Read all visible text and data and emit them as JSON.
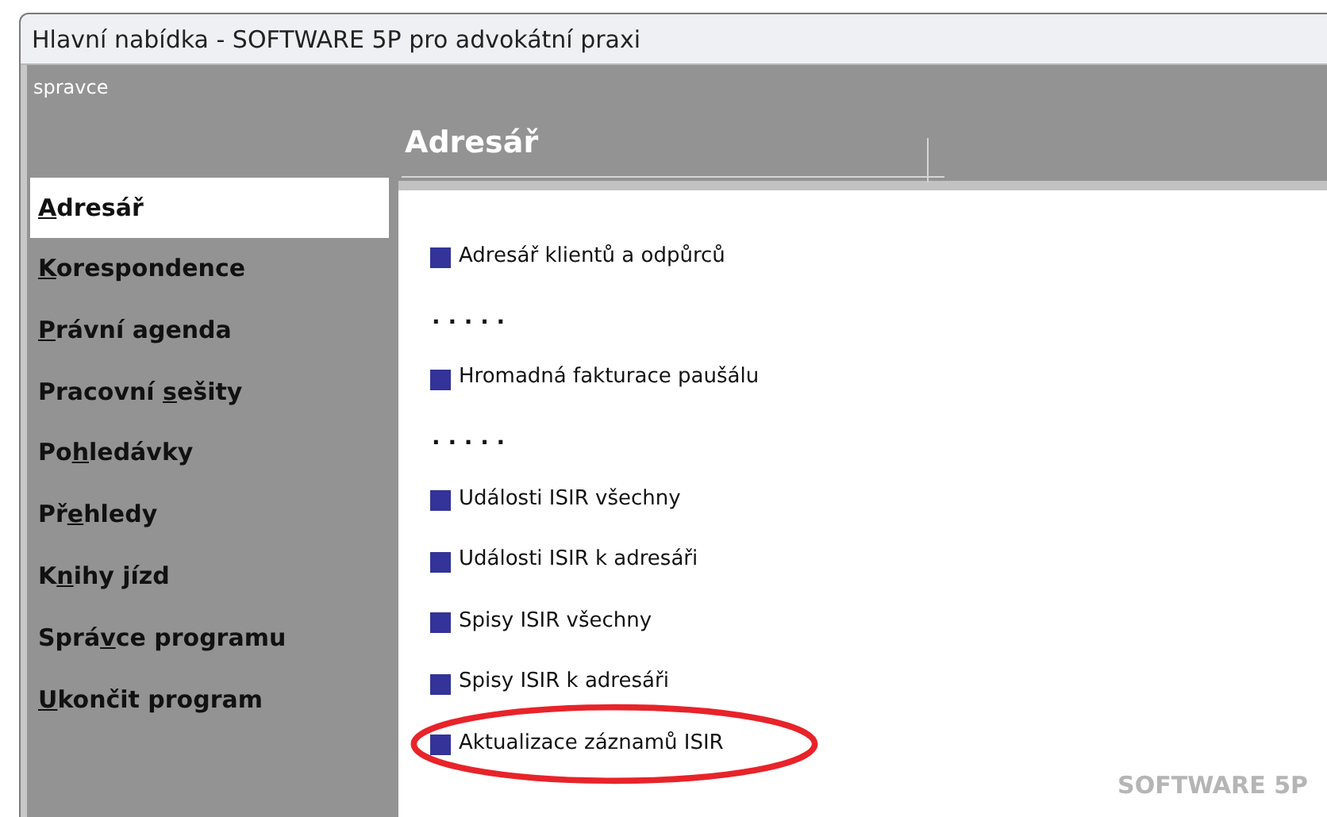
{
  "window": {
    "title": "Hlavní nabídka - SOFTWARE 5P pro advokátní praxi"
  },
  "user": "spravce",
  "sidebar": {
    "items": [
      {
        "key": "A",
        "post": "dresář",
        "selected": true
      },
      {
        "key": "K",
        "post": "orespondence",
        "selected": false
      },
      {
        "key": "P",
        "post": "rávní agenda",
        "selected": false
      },
      {
        "pre": "Pracovní ",
        "key": "s",
        "post": "ešity",
        "selected": false
      },
      {
        "pre": "Po",
        "key": "h",
        "post": "ledávky",
        "selected": false
      },
      {
        "pre": "Př",
        "key": "e",
        "post": "hledy",
        "selected": false
      },
      {
        "pre": "K",
        "key": "n",
        "post": "ihy jízd",
        "selected": false
      },
      {
        "pre": "Sprá",
        "key": "v",
        "post": "ce programu",
        "selected": false
      },
      {
        "key": "U",
        "post": "končit program",
        "selected": false
      }
    ]
  },
  "panel": {
    "title": "Adresář",
    "items": [
      {
        "kind": "link",
        "label": "Adresář klientů a odpůrců"
      },
      {
        "kind": "separator",
        "label": ". . . . ."
      },
      {
        "kind": "link",
        "label": "Hromadná fakturace paušálu"
      },
      {
        "kind": "separator",
        "label": ". . . . ."
      },
      {
        "kind": "link",
        "label": "Události ISIR všechny"
      },
      {
        "kind": "link",
        "label": "Události ISIR k adresáři"
      },
      {
        "kind": "link",
        "label": "Spisy ISIR všechny"
      },
      {
        "kind": "link",
        "label": "Spisy ISIR k adresáři"
      },
      {
        "kind": "link",
        "label": "Aktualizace záznamů ISIR",
        "highlighted": true
      }
    ],
    "brand": "SOFTWARE 5P"
  }
}
